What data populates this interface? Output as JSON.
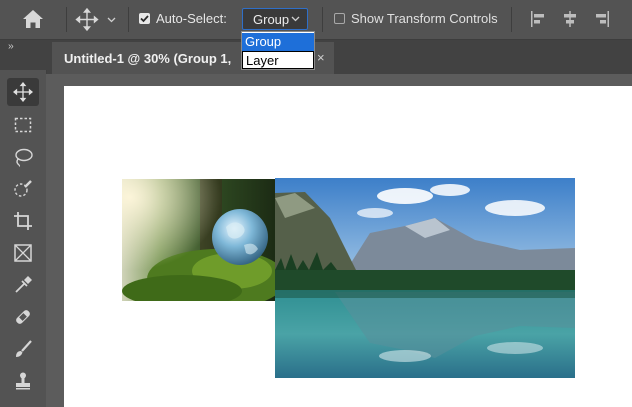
{
  "options_bar": {
    "auto_select_label": "Auto-Select:",
    "auto_select_value": "Group",
    "auto_select_checked": true,
    "show_transform_label": "Show Transform Controls",
    "show_transform_checked": false
  },
  "dropdown": {
    "options": [
      "Group",
      "Layer"
    ],
    "highlighted": "Group"
  },
  "tab": {
    "title": "Untitled-1 @ 30% (Group 1,",
    "close_glyph": "×",
    "panel_toggle": "››"
  },
  "icons": {
    "home": "home-icon",
    "move": "move-icon",
    "align": [
      "align-left-icon",
      "align-center-icon",
      "align-right-icon"
    ],
    "tools": [
      "move-tool-icon",
      "marquee-icon",
      "lasso-icon",
      "quick-select-icon",
      "crop-icon",
      "frame-icon",
      "eyedropper-icon",
      "healing-brush-icon",
      "brush-icon",
      "stamp-icon"
    ]
  },
  "colors": {
    "ui_bg": "#535353",
    "tab_row": "#424242",
    "accent": "#1e6fd9",
    "canvas": "#ffffff"
  }
}
